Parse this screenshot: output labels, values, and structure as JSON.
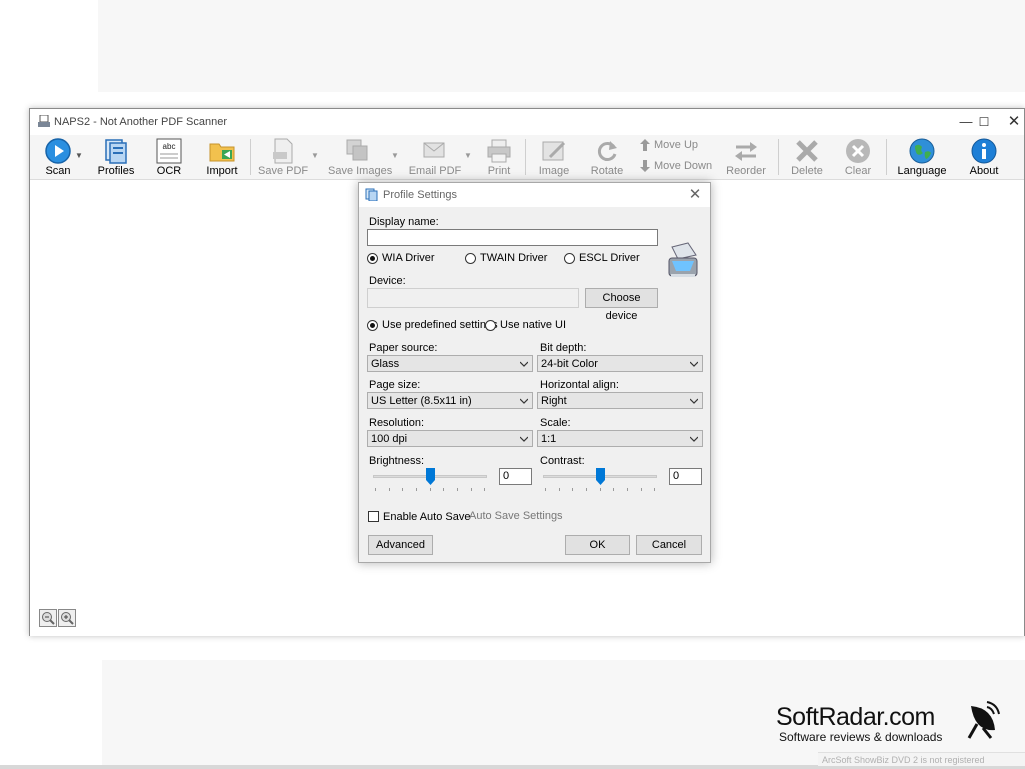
{
  "window": {
    "title": "NAPS2 - Not Another PDF Scanner"
  },
  "toolbar": {
    "scan": "Scan",
    "profiles": "Profiles",
    "ocr": "OCR",
    "import": "Import",
    "save_pdf": "Save PDF",
    "save_images": "Save Images",
    "email_pdf": "Email PDF",
    "print": "Print",
    "image": "Image",
    "rotate": "Rotate",
    "move_up": "Move Up",
    "move_down": "Move Down",
    "reorder": "Reorder",
    "delete": "Delete",
    "clear": "Clear",
    "language": "Language",
    "about": "About"
  },
  "dialog": {
    "title": "Profile Settings",
    "display_name_label": "Display name:",
    "display_name_value": "",
    "drivers": [
      "WIA Driver",
      "TWAIN Driver",
      "ESCL Driver"
    ],
    "selected_driver": "WIA Driver",
    "device_label": "Device:",
    "device_value": "",
    "choose_device": "Choose device",
    "use_predefined": "Use predefined settings",
    "use_native": "Use native UI",
    "paper_source_label": "Paper source:",
    "paper_source": "Glass",
    "bit_depth_label": "Bit depth:",
    "bit_depth": "24-bit Color",
    "page_size_label": "Page size:",
    "page_size": "US Letter (8.5x11 in)",
    "horizontal_align_label": "Horizontal align:",
    "horizontal_align": "Right",
    "resolution_label": "Resolution:",
    "resolution": "100 dpi",
    "scale_label": "Scale:",
    "scale": "1:1",
    "brightness_label": "Brightness:",
    "brightness": "0",
    "brightness_level": 0.5,
    "contrast_label": "Contrast:",
    "contrast": "0",
    "contrast_level": 0.5,
    "enable_auto_save": "Enable Auto Save",
    "auto_save_settings": "Auto Save Settings",
    "advanced": "Advanced",
    "ok": "OK",
    "cancel": "Cancel"
  },
  "watermark": {
    "brand": "SoftRadar.com",
    "tagline": "Software reviews & downloads",
    "arcsoft": "ArcSoft ShowBiz DVD 2 is not registered"
  },
  "colors": {
    "accent": "#0078d7",
    "toolbar_bg": "#f5f5f5",
    "dialog_bg": "#f0f0f0"
  }
}
